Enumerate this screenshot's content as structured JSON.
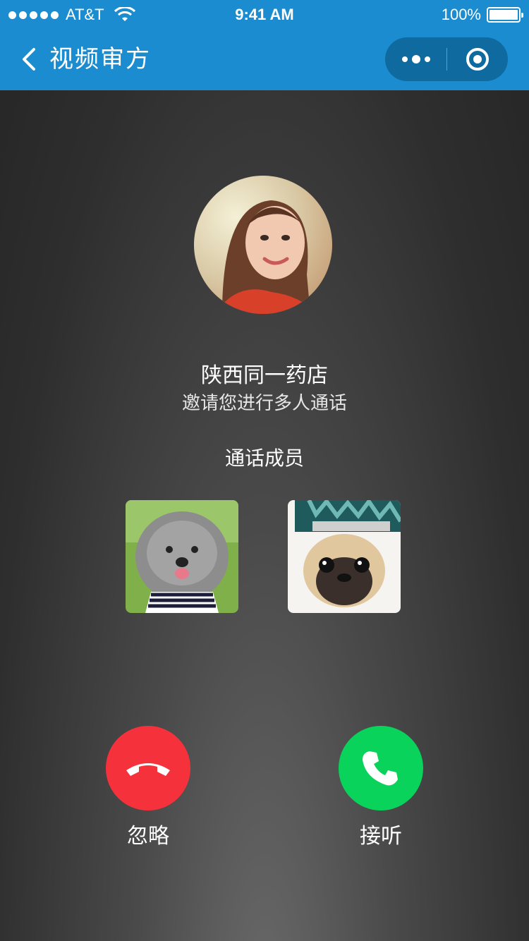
{
  "status_bar": {
    "carrier": "AT&T",
    "time": "9:41 AM",
    "battery": "100%"
  },
  "nav": {
    "title": "视频审方"
  },
  "caller": {
    "name": "陕西同一药店",
    "invite_text": "邀请您进行多人通话"
  },
  "members": {
    "title": "通话成员"
  },
  "actions": {
    "decline_label": "忽略",
    "accept_label": "接听"
  },
  "colors": {
    "nav_blue": "#1a8ccf",
    "decline_red": "#f5323c",
    "accept_green": "#09d35a"
  }
}
